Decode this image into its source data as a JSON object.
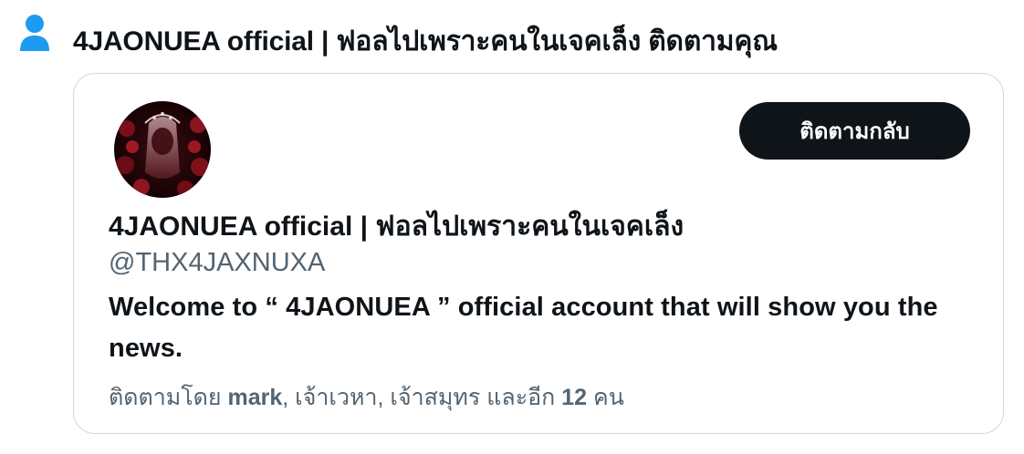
{
  "notification": {
    "icon": "person-icon",
    "title": "4JAONUEA official | ฟอลไปเพราะคนในเจคเล็ง ติดตามคุณ"
  },
  "profile_card": {
    "avatar": "profile-avatar",
    "follow_back_label": "ติดตามกลับ",
    "display_name": "4JAONUEA official | ฟอลไปเพราะคนในเจคเล็ง",
    "handle": "@THX4JAXNUXA",
    "bio": "Welcome to “ 4JAONUEA ” official account that will show you the news.",
    "followed_by": {
      "prefix": "ติดตามโดย",
      "user1": "mark",
      "user2": "เจ้าเวหา",
      "user3": "เจ้าสมุทร",
      "and_text": "และอีก",
      "others_count": "12",
      "people_word": "คน"
    }
  },
  "colors": {
    "accent_blue": "#1d9bf0",
    "text_primary": "#0f1419",
    "text_secondary": "#536471",
    "button_bg": "#0f1419",
    "card_border": "#cfd9de"
  }
}
